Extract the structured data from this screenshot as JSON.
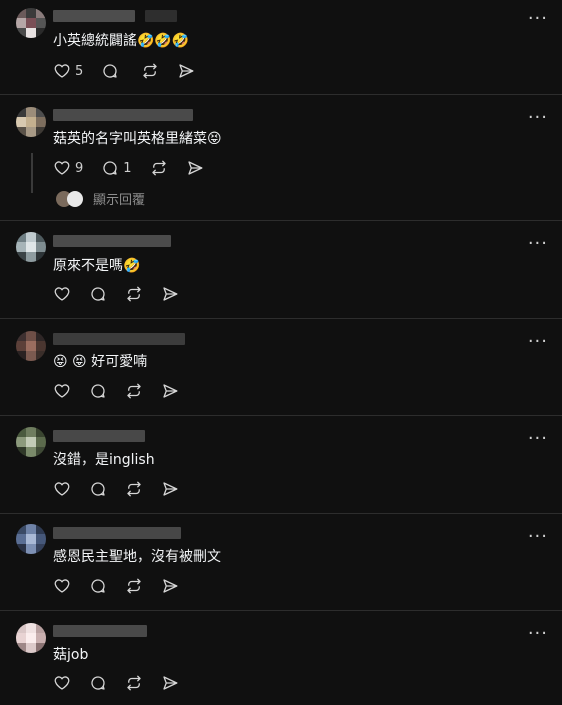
{
  "posts": [
    {
      "text": "小英總統闢謠🤣🤣🤣",
      "actions": {
        "like_count": "5",
        "reply_count": "",
        "repost_count": "",
        "share_count": ""
      }
    },
    {
      "text": "菇英的名字叫英格里緒菜😝",
      "actions": {
        "like_count": "9",
        "reply_count": "1",
        "repost_count": "",
        "share_count": ""
      },
      "show_replies": "顯示回覆"
    },
    {
      "text": "原來不是嗎🤣",
      "actions": {
        "like_count": "",
        "reply_count": "",
        "repost_count": "",
        "share_count": ""
      }
    },
    {
      "text": "😝 😝 好可愛喃",
      "actions": {
        "like_count": "",
        "reply_count": "",
        "repost_count": "",
        "share_count": ""
      }
    },
    {
      "text": "沒錯，是inglish",
      "actions": {
        "like_count": "",
        "reply_count": "",
        "repost_count": "",
        "share_count": ""
      }
    },
    {
      "text": "感恩民主聖地，沒有被刪文",
      "actions": {
        "like_count": "",
        "reply_count": "",
        "repost_count": "",
        "share_count": ""
      }
    },
    {
      "text": "菇job",
      "actions": {
        "like_count": "",
        "reply_count": "",
        "repost_count": "",
        "share_count": ""
      }
    }
  ],
  "more_label": "···",
  "icons": {
    "like": "heart-icon",
    "reply": "comment-icon",
    "repost": "repost-icon",
    "share": "send-icon",
    "more": "more-icon"
  },
  "colors": {
    "background": "#101010",
    "text": "#f3f5f7",
    "muted": "#8e8e8e",
    "divider": "#2d2d2d"
  }
}
